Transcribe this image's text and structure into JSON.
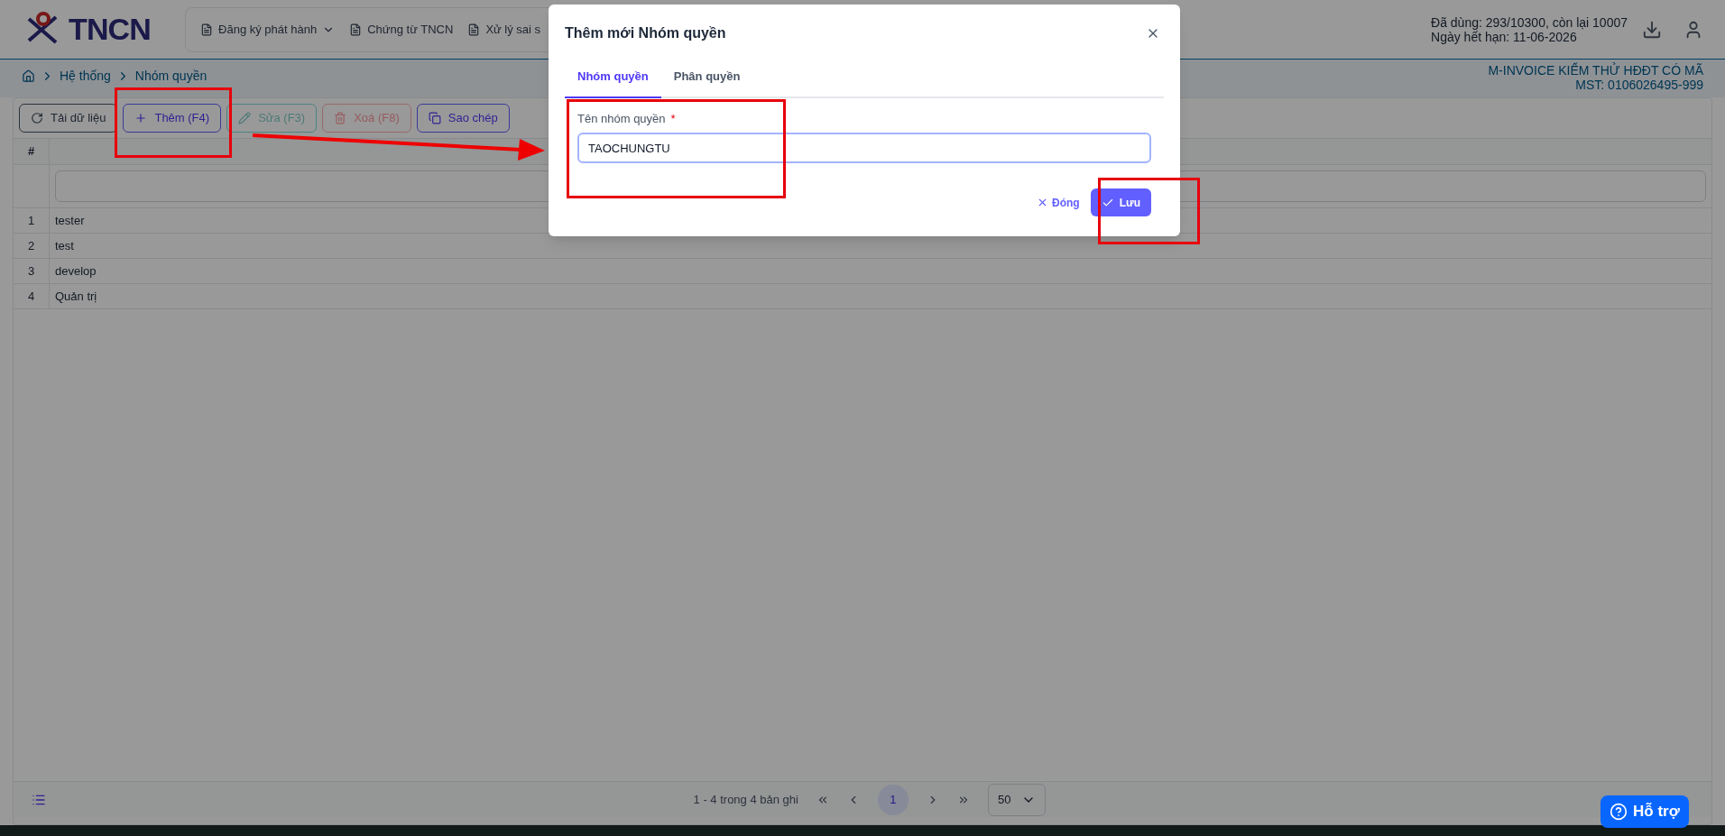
{
  "header": {
    "logo_text": "TNCN",
    "nav": [
      {
        "label": "Đăng ký phát hành",
        "has_menu": true
      },
      {
        "label": "Chứng từ TNCN",
        "has_menu": false
      },
      {
        "label": "Xử lý sai s",
        "has_menu": false
      }
    ],
    "usage": [
      "Đã dùng: 293/10300, còn lại 10007",
      "Ngày hết hạn: 11-06-2026"
    ]
  },
  "breadcrumb": [
    "Hệ thống",
    "Nhóm quyền"
  ],
  "company": {
    "name": "M-INVOICE KIỂM THỬ HĐĐT CÓ MÃ",
    "tax_id": "MST: 0106026495-999"
  },
  "toolbar": [
    {
      "kind": "reload",
      "label": "Tải dữ liệu",
      "disabled": false
    },
    {
      "kind": "add",
      "label": "Thêm (F4)",
      "disabled": false
    },
    {
      "kind": "edit",
      "label": "Sửa (F3)",
      "disabled": true
    },
    {
      "kind": "delete",
      "label": "Xoá (F8)",
      "disabled": true
    },
    {
      "kind": "copy",
      "label": "Sao chép",
      "disabled": false
    }
  ],
  "table": {
    "columns": [
      "#"
    ],
    "rows": [
      {
        "index": "1",
        "name": "tester"
      },
      {
        "index": "2",
        "name": "test"
      },
      {
        "index": "3",
        "name": "develop"
      },
      {
        "index": "4",
        "name": "Quản trị"
      }
    ]
  },
  "pagination": {
    "summary": "1 - 4 trong 4 bản ghi",
    "pages": [
      {
        "label": "1",
        "selected": true
      }
    ],
    "page_size": "50"
  },
  "help_button": "Hỗ trợ",
  "dialog": {
    "title": "Thêm mới Nhóm quyền",
    "tabs": [
      {
        "label": "Nhóm quyền",
        "selected": true
      },
      {
        "label": "Phân quyền",
        "selected": false
      }
    ],
    "field": {
      "label": "Tên nhóm quyền",
      "required": true,
      "required_mark": "*",
      "value": "TAOCHUNGTU"
    },
    "close_label": "Đóng",
    "save_label": "Lưu"
  }
}
